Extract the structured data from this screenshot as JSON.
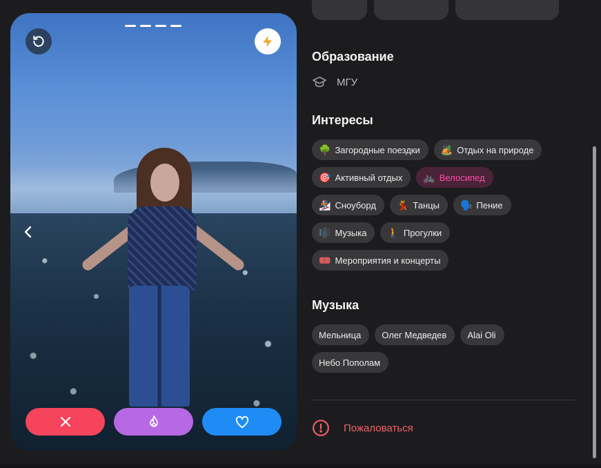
{
  "card": {
    "progress_segments": 4,
    "icons": {
      "undo": "undo-icon",
      "boost": "lightning-icon",
      "prev": "chevron-left-icon"
    },
    "actions": [
      {
        "id": "nope",
        "icon": "close-icon",
        "color": "#f5445c"
      },
      {
        "id": "superlike",
        "icon": "flame-icon",
        "color": "#b768e3"
      },
      {
        "id": "like",
        "icon": "heart-icon",
        "color": "#1f8cf5"
      }
    ]
  },
  "education": {
    "title": "Образование",
    "icon": "graduation-cap-icon",
    "value": "МГУ"
  },
  "interests": {
    "title": "Интересы",
    "items": [
      {
        "emoji": "🌳",
        "label": "Загородные поездки",
        "active": false
      },
      {
        "emoji": "🏕️",
        "label": "Отдых на природе",
        "active": false
      },
      {
        "emoji": "🎯",
        "label": "Активный отдых",
        "active": false
      },
      {
        "emoji": "🚲",
        "label": "Велосипед",
        "active": true
      },
      {
        "emoji": "🏂",
        "label": "Сноуборд",
        "active": false
      },
      {
        "emoji": "💃",
        "label": "Танцы",
        "active": false
      },
      {
        "emoji": "🗣️",
        "label": "Пение",
        "active": false
      },
      {
        "emoji": "🎼",
        "label": "Музыка",
        "active": false
      },
      {
        "emoji": "🚶",
        "label": "Прогулки",
        "active": false
      },
      {
        "emoji": "🎟️",
        "label": "Мероприятия и концерты",
        "active": false
      }
    ]
  },
  "music": {
    "title": "Музыка",
    "items": [
      "Мельница",
      "Олег Медведев",
      "Alai Oli",
      "Небо Пополам"
    ]
  },
  "report": {
    "icon": "alert-circle-icon",
    "label": "Пожаловаться",
    "color": "#f0606a"
  },
  "colors": {
    "background": "#1c1c1e",
    "chip": "#38383b",
    "chip_active_bg": "#4a2338",
    "chip_active_text": "#ff4fa3"
  }
}
